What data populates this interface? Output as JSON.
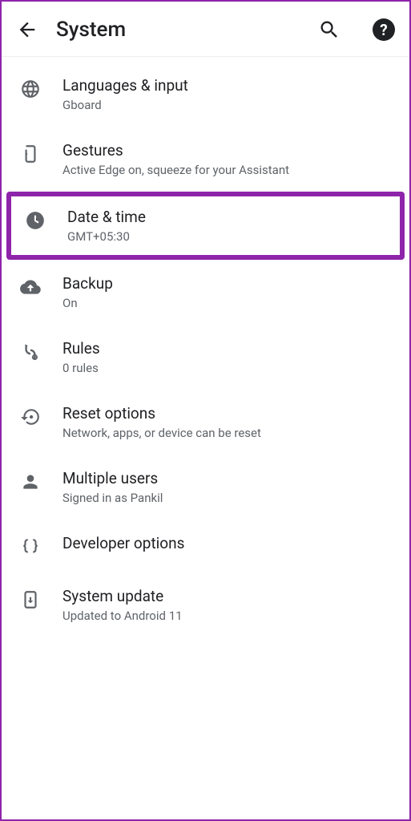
{
  "header": {
    "title": "System"
  },
  "items": [
    {
      "icon": "globe",
      "label": "Languages & input",
      "sub": "Gboard"
    },
    {
      "icon": "gesture",
      "label": "Gestures",
      "sub": "Active Edge on, squeeze for your Assistant"
    },
    {
      "icon": "clock",
      "label": "Date & time",
      "sub": "GMT+05:30",
      "highlighted": true
    },
    {
      "icon": "backup",
      "label": "Backup",
      "sub": "On"
    },
    {
      "icon": "rules",
      "label": "Rules",
      "sub": "0 rules"
    },
    {
      "icon": "reset",
      "label": "Reset options",
      "sub": "Network, apps, or device can be reset"
    },
    {
      "icon": "user",
      "label": "Multiple users",
      "sub": "Signed in as Pankil"
    },
    {
      "icon": "braces",
      "label": "Developer options",
      "sub": ""
    },
    {
      "icon": "update",
      "label": "System update",
      "sub": "Updated to Android 11"
    }
  ]
}
